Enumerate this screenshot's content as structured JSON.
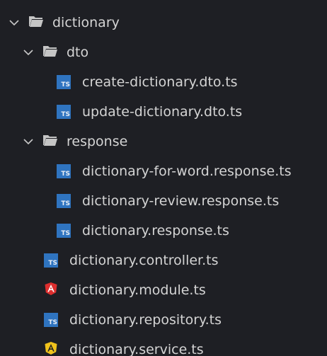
{
  "explorer": {
    "colors": {
      "background": "#1e1f24",
      "text": "#d4d4d4",
      "ts_badge": "#2f74c0",
      "angular_module": "#dd2e2e",
      "angular_service": "#f0c21b"
    },
    "items": [
      {
        "label": "dictionary",
        "type": "folder",
        "expanded": true,
        "icon": "folder-open-icon"
      },
      {
        "label": "dto",
        "type": "folder",
        "expanded": true,
        "icon": "folder-open-icon"
      },
      {
        "label": "create-dictionary.dto.ts",
        "type": "file",
        "icon": "typescript-icon",
        "badge": "TS"
      },
      {
        "label": "update-dictionary.dto.ts",
        "type": "file",
        "icon": "typescript-icon",
        "badge": "TS"
      },
      {
        "label": "response",
        "type": "folder",
        "expanded": true,
        "icon": "folder-open-icon"
      },
      {
        "label": "dictionary-for-word.response.ts",
        "type": "file",
        "icon": "typescript-icon",
        "badge": "TS"
      },
      {
        "label": "dictionary-review.response.ts",
        "type": "file",
        "icon": "typescript-icon",
        "badge": "TS"
      },
      {
        "label": "dictionary.response.ts",
        "type": "file",
        "icon": "typescript-icon",
        "badge": "TS"
      },
      {
        "label": "dictionary.controller.ts",
        "type": "file",
        "icon": "typescript-icon",
        "badge": "TS"
      },
      {
        "label": "dictionary.module.ts",
        "type": "file",
        "icon": "angular-module-icon"
      },
      {
        "label": "dictionary.repository.ts",
        "type": "file",
        "icon": "typescript-icon",
        "badge": "TS"
      },
      {
        "label": "dictionary.service.ts",
        "type": "file",
        "icon": "angular-service-icon"
      }
    ]
  }
}
